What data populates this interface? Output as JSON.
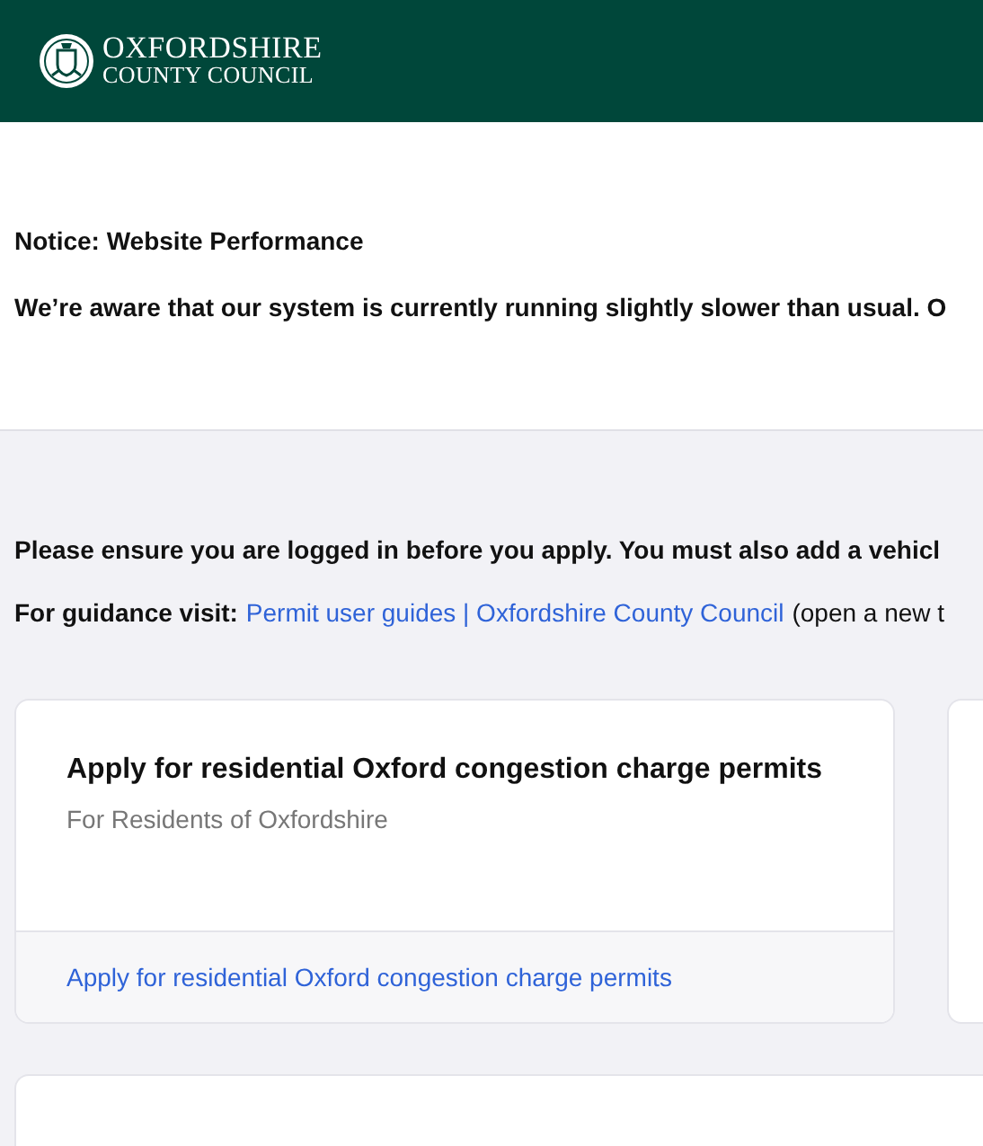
{
  "header": {
    "logo": {
      "line_1": "OXFORDSHIRE",
      "line_2": "COUNTY COUNCIL"
    }
  },
  "notice": {
    "title": "Notice: Website Performance",
    "text": "We’re aware that our system is currently running slightly slower than usual. O"
  },
  "intro": {
    "text": "Please ensure you are logged in before you apply. You must also add a vehicl",
    "guidance_label": "For guidance visit:",
    "guidance_link": "Permit user guides | Oxfordshire County Council",
    "guidance_note": "(open a new t"
  },
  "cards": [
    {
      "title": "Apply for residential Oxford congestion charge permits",
      "subtitle": "For Residents of Oxfordshire",
      "link": "Apply for residential Oxford congestion charge permits"
    }
  ]
}
